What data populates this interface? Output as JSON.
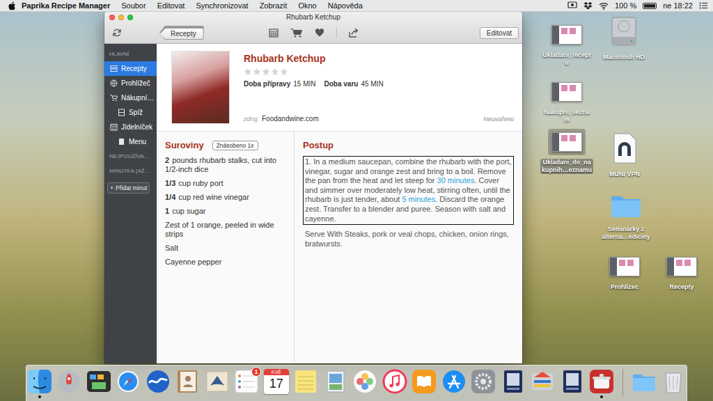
{
  "menubar": {
    "app": "Paprika Recipe Manager",
    "menus": [
      "Soubor",
      "Editovat",
      "Synchronizovat",
      "Zobrazit",
      "Okno",
      "Nápověda"
    ],
    "battery": "100 %",
    "battery_level": 1,
    "clock": "ne 18:22"
  },
  "window": {
    "title": "Rhubarb Ketchup",
    "back_button": "Recepty",
    "edit_button": "Editovat"
  },
  "sidebar": {
    "sections": [
      {
        "title": "HLAVNÍ",
        "items": [
          {
            "label": "Recepty",
            "kind": "recipes",
            "selected": true,
            "nested": false
          },
          {
            "label": "Prohlížeč",
            "kind": "browser",
            "selected": false,
            "nested": false
          },
          {
            "label": "Nákupní…",
            "kind": "cart",
            "selected": false,
            "nested": false
          },
          {
            "label": "Spíž",
            "kind": "pantry",
            "selected": false,
            "nested": true
          },
          {
            "label": "Jídelníček",
            "kind": "calendar",
            "selected": false,
            "nested": false
          },
          {
            "label": "Menu",
            "kind": "menu",
            "selected": false,
            "nested": true
          }
        ]
      },
      {
        "title": "NEJPOUŽÍVA…",
        "items": []
      },
      {
        "title": "MINUTKA (AŽ…",
        "items": []
      }
    ],
    "add_timer": {
      "icon": "+",
      "label": "Přidat minut"
    }
  },
  "recipe": {
    "title": "Rhubarb Ketchup",
    "stars": 0,
    "prep_label": "Doba přípravy",
    "prep_value": "15 MIN",
    "cook_label": "Doba varu",
    "cook_value": "45 MIN",
    "source_label": "zdroj:",
    "source": "Foodandwine.com",
    "status": "Neuvařeno"
  },
  "ingredients": {
    "title": "Suroviny",
    "scale_button": "Znásobeno 1x",
    "items": [
      {
        "amount": "2",
        "text": "pounds rhubarb stalks, cut into 1/2-inch dice"
      },
      {
        "amount": "1/3",
        "text": "cup ruby port"
      },
      {
        "amount": "1/4",
        "text": "cup red wine vinegar"
      },
      {
        "amount": "1",
        "text": "cup sugar"
      },
      {
        "amount": "",
        "text": "Zest of 1 orange, peeled in wide strips"
      },
      {
        "amount": "",
        "text": "Salt"
      },
      {
        "amount": "",
        "text": "Cayenne pepper"
      }
    ]
  },
  "directions": {
    "title": "Postup",
    "steps": [
      {
        "highlighted": true,
        "segments": [
          {
            "text": "1. In a medium saucepan, combine the rhubarb with the port, vinegar, sugar and orange zest and bring to a boil. Remove the pan from the heat and let steep for ",
            "link": false
          },
          {
            "text": "30 minutes",
            "link": true
          },
          {
            "text": ". Cover and simmer over moderately low heat, stirring often, until the rhubarb is just tender, about ",
            "link": false
          },
          {
            "text": "5 minutes",
            "link": true
          },
          {
            "text": ". Discard the orange zest. Transfer to a blender and puree. Season with salt and cayenne.",
            "link": false
          }
        ]
      }
    ],
    "notes": "Serve With Steaks, pork or veal chops, chicken, onion rings, bratwursts."
  },
  "desktop_icons": [
    {
      "kind": "screenshot",
      "lines": [
        "Ukladani_recept",
        "u"
      ],
      "selected": false
    },
    {
      "kind": "disk",
      "lines": [
        "Macintosh HD"
      ],
      "selected": false
    },
    {
      "kind": "screenshot",
      "lines": [
        "Nakupni_sezna",
        "m"
      ],
      "selected": false
    },
    {
      "kind": "screenshot",
      "lines": [
        "Ukladani_do_na",
        "kupnih…eznamu"
      ],
      "selected": true
    },
    {
      "kind": "vpn",
      "lines": [
        "MUNI VPN"
      ],
      "selected": false
    },
    {
      "kind": "folder",
      "lines": [
        "Seminárky z",
        "alterna…ediciny"
      ],
      "selected": false
    },
    {
      "kind": "screenshot",
      "lines": [
        "Prohlizec"
      ],
      "selected": false
    },
    {
      "kind": "screenshot",
      "lines": [
        "Recepty"
      ],
      "selected": false
    }
  ],
  "dock": {
    "apps": [
      {
        "kind": "finder",
        "running": true
      },
      {
        "kind": "launchpad",
        "running": false
      },
      {
        "kind": "mission-control",
        "running": false
      },
      {
        "kind": "safari",
        "running": false
      },
      {
        "kind": "wave",
        "running": false
      },
      {
        "kind": "contacts",
        "running": false
      },
      {
        "kind": "mail",
        "running": false
      },
      {
        "kind": "reminders",
        "running": false,
        "badge": "1"
      },
      {
        "kind": "calendar",
        "running": false,
        "month": "KVĚ",
        "day": "17"
      },
      {
        "kind": "notes",
        "running": false
      },
      {
        "kind": "preview",
        "running": false
      },
      {
        "kind": "photos",
        "running": false
      },
      {
        "kind": "itunes",
        "running": false
      },
      {
        "kind": "ibooks",
        "running": false
      },
      {
        "kind": "app-store",
        "running": false
      },
      {
        "kind": "system-preferences",
        "running": false
      },
      {
        "kind": "scanner",
        "running": false
      },
      {
        "kind": "scanner-color",
        "running": false
      },
      {
        "kind": "scanner",
        "running": false
      },
      {
        "kind": "paprika",
        "running": true
      }
    ],
    "stacks": [
      {
        "kind": "folder",
        "running": false
      },
      {
        "kind": "trash",
        "running": false
      }
    ]
  }
}
